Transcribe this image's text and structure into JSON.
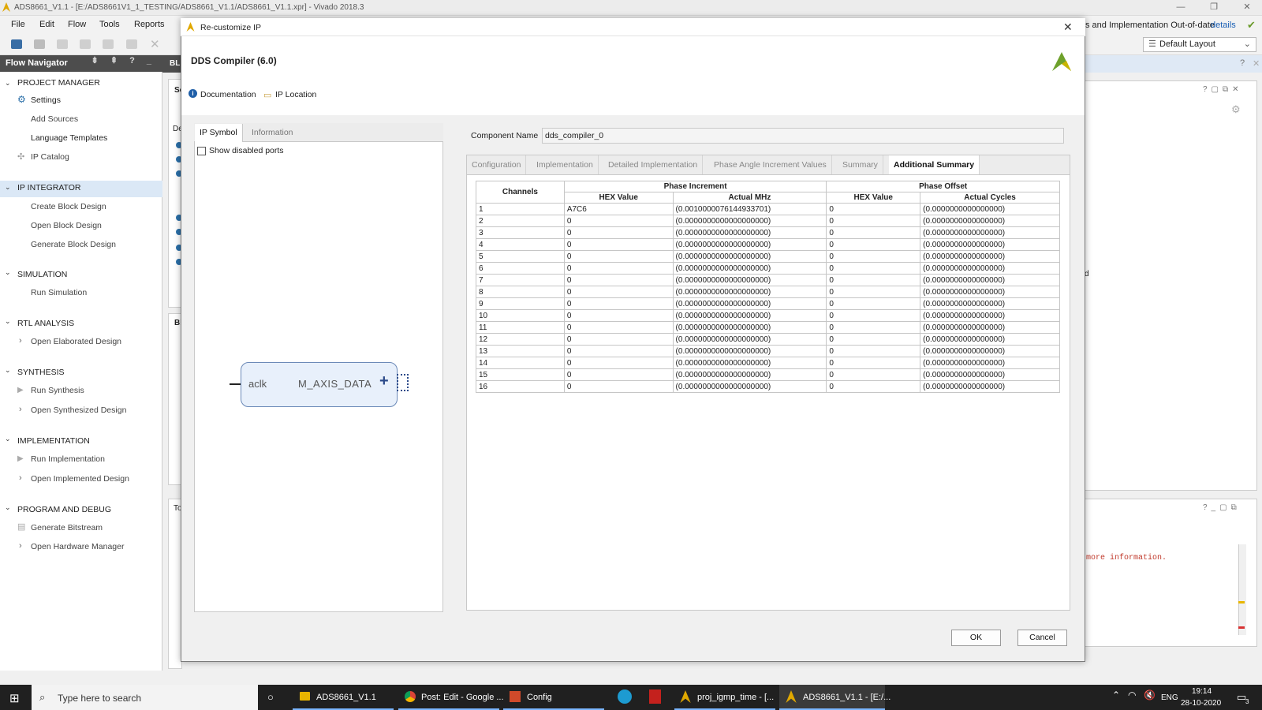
{
  "window": {
    "title": "ADS8661_V1.1 - [E:/ADS8661V1_1_TESTING/ADS8661_V1.1/ADS8661_V1.1.xpr] - Vivado 2018.3"
  },
  "menu": [
    "File",
    "Edit",
    "Flow",
    "Tools",
    "Reports"
  ],
  "status_bar": {
    "text": "s and Implementation Out-of-date",
    "details_link": "details"
  },
  "layout_select": "Default Layout",
  "flow_navigator": {
    "title": "Flow Navigator",
    "sections": [
      {
        "title": "PROJECT MANAGER",
        "items": [
          "Settings",
          "Add Sources",
          "Language Templates",
          "IP Catalog"
        ]
      },
      {
        "title": "IP INTEGRATOR",
        "items": [
          "Create Block Design",
          "Open Block Design",
          "Generate Block Design"
        ]
      },
      {
        "title": "SIMULATION",
        "items": [
          "Run Simulation"
        ]
      },
      {
        "title": "RTL ANALYSIS",
        "items": [
          "Open Elaborated Design"
        ]
      },
      {
        "title": "SYNTHESIS",
        "items": [
          "Run Synthesis",
          "Open Synthesized Design"
        ]
      },
      {
        "title": "IMPLEMENTATION",
        "items": [
          "Run Implementation",
          "Open Implemented Design"
        ]
      },
      {
        "title": "PROGRAM AND DEBUG",
        "items": [
          "Generate Bitstream",
          "Open Hardware Manager"
        ]
      }
    ]
  },
  "background_fragments": {
    "bl1": "BL",
    "so": "So",
    "de": "De",
    "bl2": "Bl",
    "to": "To",
    "d_fragment": "d",
    "console_text": "more information."
  },
  "dialog": {
    "title": "Re-customize IP",
    "ip_name": "DDS Compiler (6.0)",
    "links": {
      "documentation": "Documentation",
      "ip_location": "IP Location"
    },
    "left_tabs": [
      "IP Symbol",
      "Information"
    ],
    "show_disabled_ports": "Show disabled ports",
    "symbol": {
      "input_port": "aclk",
      "output_port": "M_AXIS_DATA"
    },
    "component_name_label": "Component Name",
    "component_name_value": "dds_compiler_0",
    "tabs": [
      "Configuration",
      "Implementation",
      "Detailed Implementation",
      "Phase Angle Increment Values",
      "Summary",
      "Additional Summary"
    ],
    "active_tab": "Additional Summary",
    "table": {
      "channels_header": "Channels",
      "group_headers": [
        "Phase Increment",
        "Phase Offset"
      ],
      "sub_headers": [
        "HEX Value",
        "Actual MHz",
        "HEX Value",
        "Actual Cycles"
      ],
      "rows": [
        [
          "1",
          "A7C6",
          "(0.0010000076144933701)",
          "0",
          "(0.0000000000000000)"
        ],
        [
          "2",
          "0",
          "(0.0000000000000000000)",
          "0",
          "(0.0000000000000000)"
        ],
        [
          "3",
          "0",
          "(0.0000000000000000000)",
          "0",
          "(0.0000000000000000)"
        ],
        [
          "4",
          "0",
          "(0.0000000000000000000)",
          "0",
          "(0.0000000000000000)"
        ],
        [
          "5",
          "0",
          "(0.0000000000000000000)",
          "0",
          "(0.0000000000000000)"
        ],
        [
          "6",
          "0",
          "(0.0000000000000000000)",
          "0",
          "(0.0000000000000000)"
        ],
        [
          "7",
          "0",
          "(0.0000000000000000000)",
          "0",
          "(0.0000000000000000)"
        ],
        [
          "8",
          "0",
          "(0.0000000000000000000)",
          "0",
          "(0.0000000000000000)"
        ],
        [
          "9",
          "0",
          "(0.0000000000000000000)",
          "0",
          "(0.0000000000000000)"
        ],
        [
          "10",
          "0",
          "(0.0000000000000000000)",
          "0",
          "(0.0000000000000000)"
        ],
        [
          "11",
          "0",
          "(0.0000000000000000000)",
          "0",
          "(0.0000000000000000)"
        ],
        [
          "12",
          "0",
          "(0.0000000000000000000)",
          "0",
          "(0.0000000000000000)"
        ],
        [
          "13",
          "0",
          "(0.0000000000000000000)",
          "0",
          "(0.0000000000000000)"
        ],
        [
          "14",
          "0",
          "(0.0000000000000000000)",
          "0",
          "(0.0000000000000000)"
        ],
        [
          "15",
          "0",
          "(0.0000000000000000000)",
          "0",
          "(0.0000000000000000)"
        ],
        [
          "16",
          "0",
          "(0.0000000000000000000)",
          "0",
          "(0.0000000000000000)"
        ]
      ]
    },
    "ok_label": "OK",
    "cancel_label": "Cancel"
  },
  "taskbar": {
    "search_placeholder": "Type here to search",
    "items": [
      "ADS8661_V1.1",
      "Post: Edit - Google ...",
      "Config",
      "proj_igmp_time - [...",
      "ADS8661_V1.1 - [E:/..."
    ],
    "language": "ENG",
    "time": "19:14",
    "date": "28-10-2020",
    "notification_count": "3"
  },
  "colors": {
    "accent_blue": "#2b6fa8",
    "nav_selected": "#dbe8f6",
    "flow_header": "#4d4d4d",
    "taskbar": "#202020"
  }
}
